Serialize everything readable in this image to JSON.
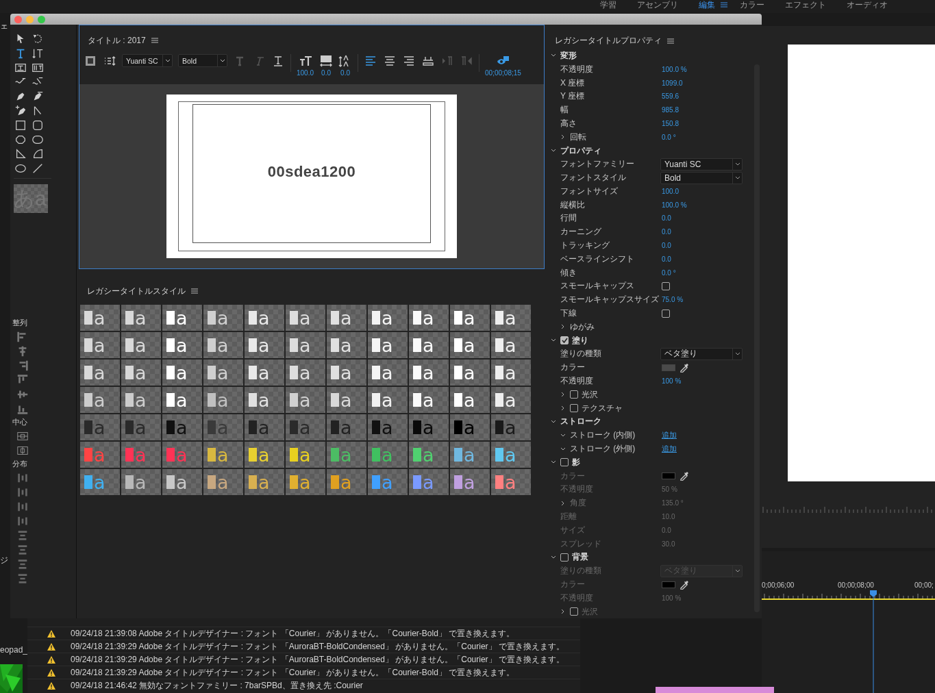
{
  "workspace_tabs": [
    {
      "label": "学習",
      "selected": false
    },
    {
      "label": "アセンブリ",
      "selected": false
    },
    {
      "label": "編集",
      "selected": true
    },
    {
      "label": "カラー",
      "selected": false
    },
    {
      "label": "エフェクト",
      "selected": false
    },
    {
      "label": "オーディオ",
      "selected": false
    }
  ],
  "left_panel_fragments": [
    "ェ",
    "ジ",
    "eopad_"
  ],
  "timeline": {
    "times": [
      "0;00;06;00",
      "00;00;08;00",
      "00;00;"
    ]
  },
  "log": [
    {
      "kind": "warning",
      "text": "09/24/18 21:39:08 Adobe タイトルデザイナー : フォント 「Courier」 がありません。「Courier-Bold」 で置き換えます。"
    },
    {
      "kind": "warning",
      "text": "09/24/18 21:39:29 Adobe タイトルデザイナー : フォント 「AuroraBT-BoldCondensed」 がありません。「Courier」 で置き換えます。"
    },
    {
      "kind": "warning",
      "text": "09/24/18 21:39:29 Adobe タイトルデザイナー : フォント 「AuroraBT-BoldCondensed」 がありません。「Courier」 で置き換えます。"
    },
    {
      "kind": "warning",
      "text": "09/24/18 21:39:29 Adobe タイトルデザイナー : フォント 「Courier」 がありません。「Courier-Bold」 で置き換えます。"
    },
    {
      "kind": "warning",
      "text": "09/24/18 21:46:42 無効なフォントファミリー : 7barSPBd、置き換え先 :Courier"
    }
  ],
  "title_designer": {
    "title": "タイトル : 2017",
    "toolbar": {
      "font_family": "Yuanti SC",
      "font_style": "Bold",
      "font_size": "100.0",
      "kerning": "0.0",
      "leading": "0.0",
      "timecode": "00;00;08;15"
    },
    "canvas_text": "00sdea1200",
    "style_preview": "あa",
    "align_sections": [
      "整列",
      "中心",
      "分布"
    ],
    "styles_panel": {
      "title": "レガシータイトルスタイル",
      "rows": [
        [
          {
            "sample": "a",
            "color": "#d8d8d8"
          },
          {
            "sample": "a",
            "color": "#d8d8d8"
          },
          {
            "sample": "a",
            "color": "#ffffff"
          },
          {
            "sample": "a",
            "color": "#cfcfcf"
          },
          {
            "sample": "a",
            "color": "#e8e8e8"
          },
          {
            "sample": "a",
            "color": "#dddddd"
          },
          {
            "sample": "a",
            "color": "#e0e0e0"
          },
          {
            "sample": "a",
            "color": "#f4f4f4"
          },
          {
            "sample": "a",
            "color": "#fafafa"
          },
          {
            "sample": "a",
            "color": "#ffffff"
          },
          {
            "sample": "a",
            "color": "#eeeeee"
          }
        ],
        [
          {
            "sample": "a",
            "color": "#d8d8d8"
          },
          {
            "sample": "a",
            "color": "#d8d8d8"
          },
          {
            "sample": "a",
            "color": "#ffffff"
          },
          {
            "sample": "a",
            "color": "#cfcfcf"
          },
          {
            "sample": "a",
            "color": "#e8e8e8"
          },
          {
            "sample": "a",
            "color": "#dddddd"
          },
          {
            "sample": "a",
            "color": "#e0e0e0"
          },
          {
            "sample": "a",
            "color": "#f4f4f4"
          },
          {
            "sample": "a",
            "color": "#fafafa"
          },
          {
            "sample": "a",
            "color": "#ffffff"
          },
          {
            "sample": "a",
            "color": "#eeeeee"
          }
        ],
        [
          {
            "sample": "a",
            "color": "#d8d8d8"
          },
          {
            "sample": "a",
            "color": "#d8d8d8"
          },
          {
            "sample": "a",
            "color": "#ffffff"
          },
          {
            "sample": "a",
            "color": "#cfcfcf"
          },
          {
            "sample": "a",
            "color": "#e8e8e8"
          },
          {
            "sample": "a",
            "color": "#dddddd"
          },
          {
            "sample": "a",
            "color": "#e0e0e0"
          },
          {
            "sample": "a",
            "color": "#f4f4f4"
          },
          {
            "sample": "a",
            "color": "#fafafa"
          },
          {
            "sample": "a",
            "color": "#ffffff"
          },
          {
            "sample": "a",
            "color": "#eeeeee"
          }
        ],
        [
          {
            "sample": "a",
            "color": "#cccccc"
          },
          {
            "sample": "a",
            "color": "#cccccc"
          },
          {
            "sample": "a",
            "color": "#ffffff"
          },
          {
            "sample": "a",
            "color": "#c0c0c0"
          },
          {
            "sample": "a",
            "color": "#e0e0e0"
          },
          {
            "sample": "a",
            "color": "#d0d0d0"
          },
          {
            "sample": "a",
            "color": "#d8d8d8"
          },
          {
            "sample": "a",
            "color": "#f0f0f0"
          },
          {
            "sample": "a",
            "color": "#fafafa"
          },
          {
            "sample": "a",
            "color": "#ffffff"
          },
          {
            "sample": "a",
            "color": "#eeeeee"
          }
        ],
        [
          {
            "sample": "a",
            "color": "#2a2a2a"
          },
          {
            "sample": "a",
            "color": "#2a2a2a"
          },
          {
            "sample": "a",
            "color": "#111111"
          },
          {
            "sample": "a",
            "color": "#3a3a3a"
          },
          {
            "sample": "a",
            "color": "#222222"
          },
          {
            "sample": "a",
            "color": "#2a2a2a"
          },
          {
            "sample": "a",
            "color": "#222222"
          },
          {
            "sample": "a",
            "color": "#111111"
          },
          {
            "sample": "a",
            "color": "#0a0a0a"
          },
          {
            "sample": "a",
            "color": "#000000"
          },
          {
            "sample": "a",
            "color": "#1a1a1a"
          }
        ],
        [
          {
            "sample": "a",
            "color": "#ff4444"
          },
          {
            "sample": "a",
            "color": "#ff3355"
          },
          {
            "sample": "a",
            "color": "#ff3355"
          },
          {
            "sample": "a",
            "color": "#d8b840"
          },
          {
            "sample": "a",
            "color": "#e8d030"
          },
          {
            "sample": "a",
            "color": "#e8d020"
          },
          {
            "sample": "a",
            "color": "#4cbc64"
          },
          {
            "sample": "a",
            "color": "#40c060"
          },
          {
            "sample": "a",
            "color": "#50d070"
          },
          {
            "sample": "a",
            "color": "#70b8e0"
          },
          {
            "sample": "a",
            "color": "#60c8f0"
          }
        ],
        [
          {
            "sample": "a",
            "color": "#40b0f0"
          },
          {
            "sample": "a",
            "color": "#b8b8b8"
          },
          {
            "sample": "a",
            "color": "#c8c8c8"
          },
          {
            "sample": "a",
            "color": "#c8a880"
          },
          {
            "sample": "a",
            "color": "#d8b050"
          },
          {
            "sample": "a",
            "color": "#e0b030"
          },
          {
            "sample": "a",
            "color": "#e0a020"
          },
          {
            "sample": "a",
            "color": "#40a0ff"
          },
          {
            "sample": "a",
            "color": "#7a9aff"
          },
          {
            "sample": "a",
            "color": "#c0a0e0"
          },
          {
            "sample": "a",
            "color": "#ff8080"
          }
        ]
      ]
    },
    "properties": {
      "title": "レガシータイトルプロパティ",
      "rows": [
        {
          "kind": "section",
          "label": "変形",
          "expanded": true,
          "disabled": false
        },
        {
          "kind": "value",
          "label": "不透明度",
          "value": "100.0 %",
          "disabled": false
        },
        {
          "kind": "value",
          "label": "X 座標",
          "value": "1099.0",
          "disabled": false
        },
        {
          "kind": "value",
          "label": "Y 座標",
          "value": "559.6",
          "disabled": false
        },
        {
          "kind": "value",
          "label": "幅",
          "value": "985.8",
          "disabled": false
        },
        {
          "kind": "value",
          "label": "高さ",
          "value": "150.8",
          "disabled": false
        },
        {
          "kind": "group",
          "label": "回転",
          "value": "0.0 °",
          "expanded": false,
          "disabled": false
        },
        {
          "kind": "section",
          "label": "プロパティ",
          "expanded": true,
          "disabled": false
        },
        {
          "kind": "dropdown",
          "label": "フォントファミリー",
          "value": "Yuanti SC",
          "disabled": false
        },
        {
          "kind": "dropdown",
          "label": "フォントスタイル",
          "value": "Bold",
          "disabled": false
        },
        {
          "kind": "value",
          "label": "フォントサイズ",
          "value": "100.0",
          "disabled": false
        },
        {
          "kind": "value",
          "label": "縦横比",
          "value": "100.0 %",
          "disabled": false
        },
        {
          "kind": "value",
          "label": "行間",
          "value": "0.0",
          "disabled": false
        },
        {
          "kind": "value",
          "label": "カーニング",
          "value": "0.0",
          "disabled": false
        },
        {
          "kind": "value",
          "label": "トラッキング",
          "value": "0.0",
          "disabled": false
        },
        {
          "kind": "value",
          "label": "ベースラインシフト",
          "value": "0.0",
          "disabled": false
        },
        {
          "kind": "value",
          "label": "傾き",
          "value": "0.0 °",
          "disabled": false
        },
        {
          "kind": "checkbox",
          "label": "スモールキャップス",
          "checked": false,
          "disabled": false
        },
        {
          "kind": "value",
          "label": "スモールキャップスサイズ",
          "value": "75.0 %",
          "disabled": false
        },
        {
          "kind": "checkbox",
          "label": "下線",
          "checked": false,
          "disabled": false
        },
        {
          "kind": "group",
          "label": "ゆがみ",
          "expanded": false,
          "disabled": false
        },
        {
          "kind": "section",
          "label": "塗り",
          "expanded": true,
          "checked": true,
          "disabled": false
        },
        {
          "kind": "dropdown",
          "label": "塗りの種類",
          "value": "ベタ塗り",
          "disabled": false
        },
        {
          "kind": "color",
          "label": "カラー",
          "color": "#4a4a4a",
          "disabled": false
        },
        {
          "kind": "value",
          "label": "不透明度",
          "value": "100 %",
          "disabled": false
        },
        {
          "kind": "group",
          "label": "光沢",
          "expanded": false,
          "checked": false,
          "disabled": false
        },
        {
          "kind": "group",
          "label": "テクスチャ",
          "expanded": false,
          "checked": false,
          "disabled": false
        },
        {
          "kind": "section",
          "label": "ストローク",
          "expanded": true,
          "disabled": false
        },
        {
          "kind": "link",
          "label": "ストローク (内側)",
          "value": "追加",
          "expanded": true,
          "disabled": false
        },
        {
          "kind": "link",
          "label": "ストローク (外側)",
          "value": "追加",
          "expanded": true,
          "disabled": false
        },
        {
          "kind": "section",
          "label": "影",
          "expanded": true,
          "checked": false,
          "disabled": false
        },
        {
          "kind": "color",
          "label": "カラー",
          "color": "#000000",
          "disabled": true
        },
        {
          "kind": "value",
          "label": "不透明度",
          "value": "50 %",
          "disabled": true
        },
        {
          "kind": "group",
          "label": "角度",
          "value": "135.0 °",
          "expanded": false,
          "disabled": true
        },
        {
          "kind": "value",
          "label": "距離",
          "value": "10.0",
          "disabled": true
        },
        {
          "kind": "value",
          "label": "サイズ",
          "value": "0.0",
          "disabled": true
        },
        {
          "kind": "value",
          "label": "スプレッド",
          "value": "30.0",
          "disabled": true
        },
        {
          "kind": "section",
          "label": "背景",
          "expanded": true,
          "checked": false,
          "disabled": false
        },
        {
          "kind": "dropdown",
          "label": "塗りの種類",
          "value": "ベタ塗り",
          "disabled": true
        },
        {
          "kind": "color",
          "label": "カラー",
          "color": "#000000",
          "disabled": true
        },
        {
          "kind": "value",
          "label": "不透明度",
          "value": "100 %",
          "disabled": true
        },
        {
          "kind": "group",
          "label": "光沢",
          "expanded": false,
          "checked": false,
          "disabled": true
        }
      ]
    }
  }
}
